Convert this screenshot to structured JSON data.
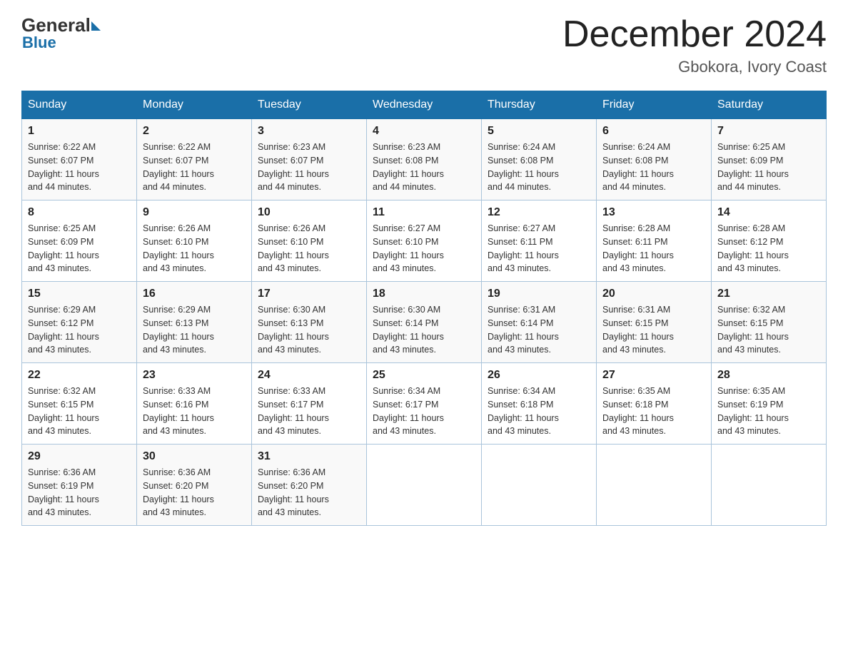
{
  "logo": {
    "general": "General",
    "blue": "Blue"
  },
  "title": {
    "month_year": "December 2024",
    "location": "Gbokora, Ivory Coast"
  },
  "days_of_week": [
    "Sunday",
    "Monday",
    "Tuesday",
    "Wednesday",
    "Thursday",
    "Friday",
    "Saturday"
  ],
  "weeks": [
    [
      {
        "day": "1",
        "sunrise": "6:22 AM",
        "sunset": "6:07 PM",
        "daylight": "11 hours and 44 minutes."
      },
      {
        "day": "2",
        "sunrise": "6:22 AM",
        "sunset": "6:07 PM",
        "daylight": "11 hours and 44 minutes."
      },
      {
        "day": "3",
        "sunrise": "6:23 AM",
        "sunset": "6:07 PM",
        "daylight": "11 hours and 44 minutes."
      },
      {
        "day": "4",
        "sunrise": "6:23 AM",
        "sunset": "6:08 PM",
        "daylight": "11 hours and 44 minutes."
      },
      {
        "day": "5",
        "sunrise": "6:24 AM",
        "sunset": "6:08 PM",
        "daylight": "11 hours and 44 minutes."
      },
      {
        "day": "6",
        "sunrise": "6:24 AM",
        "sunset": "6:08 PM",
        "daylight": "11 hours and 44 minutes."
      },
      {
        "day": "7",
        "sunrise": "6:25 AM",
        "sunset": "6:09 PM",
        "daylight": "11 hours and 44 minutes."
      }
    ],
    [
      {
        "day": "8",
        "sunrise": "6:25 AM",
        "sunset": "6:09 PM",
        "daylight": "11 hours and 43 minutes."
      },
      {
        "day": "9",
        "sunrise": "6:26 AM",
        "sunset": "6:10 PM",
        "daylight": "11 hours and 43 minutes."
      },
      {
        "day": "10",
        "sunrise": "6:26 AM",
        "sunset": "6:10 PM",
        "daylight": "11 hours and 43 minutes."
      },
      {
        "day": "11",
        "sunrise": "6:27 AM",
        "sunset": "6:10 PM",
        "daylight": "11 hours and 43 minutes."
      },
      {
        "day": "12",
        "sunrise": "6:27 AM",
        "sunset": "6:11 PM",
        "daylight": "11 hours and 43 minutes."
      },
      {
        "day": "13",
        "sunrise": "6:28 AM",
        "sunset": "6:11 PM",
        "daylight": "11 hours and 43 minutes."
      },
      {
        "day": "14",
        "sunrise": "6:28 AM",
        "sunset": "6:12 PM",
        "daylight": "11 hours and 43 minutes."
      }
    ],
    [
      {
        "day": "15",
        "sunrise": "6:29 AM",
        "sunset": "6:12 PM",
        "daylight": "11 hours and 43 minutes."
      },
      {
        "day": "16",
        "sunrise": "6:29 AM",
        "sunset": "6:13 PM",
        "daylight": "11 hours and 43 minutes."
      },
      {
        "day": "17",
        "sunrise": "6:30 AM",
        "sunset": "6:13 PM",
        "daylight": "11 hours and 43 minutes."
      },
      {
        "day": "18",
        "sunrise": "6:30 AM",
        "sunset": "6:14 PM",
        "daylight": "11 hours and 43 minutes."
      },
      {
        "day": "19",
        "sunrise": "6:31 AM",
        "sunset": "6:14 PM",
        "daylight": "11 hours and 43 minutes."
      },
      {
        "day": "20",
        "sunrise": "6:31 AM",
        "sunset": "6:15 PM",
        "daylight": "11 hours and 43 minutes."
      },
      {
        "day": "21",
        "sunrise": "6:32 AM",
        "sunset": "6:15 PM",
        "daylight": "11 hours and 43 minutes."
      }
    ],
    [
      {
        "day": "22",
        "sunrise": "6:32 AM",
        "sunset": "6:15 PM",
        "daylight": "11 hours and 43 minutes."
      },
      {
        "day": "23",
        "sunrise": "6:33 AM",
        "sunset": "6:16 PM",
        "daylight": "11 hours and 43 minutes."
      },
      {
        "day": "24",
        "sunrise": "6:33 AM",
        "sunset": "6:17 PM",
        "daylight": "11 hours and 43 minutes."
      },
      {
        "day": "25",
        "sunrise": "6:34 AM",
        "sunset": "6:17 PM",
        "daylight": "11 hours and 43 minutes."
      },
      {
        "day": "26",
        "sunrise": "6:34 AM",
        "sunset": "6:18 PM",
        "daylight": "11 hours and 43 minutes."
      },
      {
        "day": "27",
        "sunrise": "6:35 AM",
        "sunset": "6:18 PM",
        "daylight": "11 hours and 43 minutes."
      },
      {
        "day": "28",
        "sunrise": "6:35 AM",
        "sunset": "6:19 PM",
        "daylight": "11 hours and 43 minutes."
      }
    ],
    [
      {
        "day": "29",
        "sunrise": "6:36 AM",
        "sunset": "6:19 PM",
        "daylight": "11 hours and 43 minutes."
      },
      {
        "day": "30",
        "sunrise": "6:36 AM",
        "sunset": "6:20 PM",
        "daylight": "11 hours and 43 minutes."
      },
      {
        "day": "31",
        "sunrise": "6:36 AM",
        "sunset": "6:20 PM",
        "daylight": "11 hours and 43 minutes."
      },
      null,
      null,
      null,
      null
    ]
  ],
  "labels": {
    "sunrise": "Sunrise:",
    "sunset": "Sunset:",
    "daylight": "Daylight:"
  }
}
